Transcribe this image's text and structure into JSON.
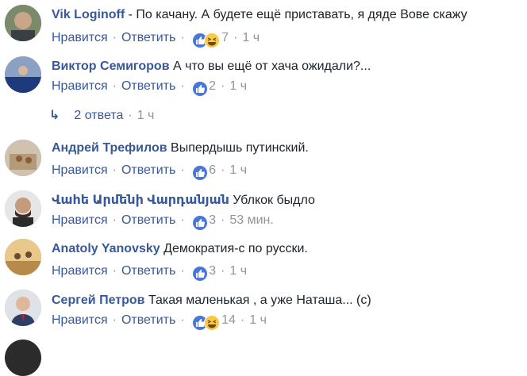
{
  "labels": {
    "like": "Нравится",
    "reply": "Ответить",
    "dot": "·"
  },
  "colors": {
    "link": "#385898",
    "meta": "#90949c",
    "text": "#1d2129",
    "like_badge": "#4a76d9",
    "haha_badge": "#f7c947"
  },
  "comments": [
    {
      "author": "Vik Loginoff",
      "text": "- По качану. А будете ещё приставать, я дяде Вове скажу",
      "reactions": [
        "like-icon",
        "haha-icon"
      ],
      "count": "7",
      "time": "1 ч"
    },
    {
      "author": "Виктор Семигоров",
      "text": "А что вы ещё от хача ожидали?...",
      "reactions": [
        "like-icon"
      ],
      "count": "2",
      "time": "1 ч"
    },
    {
      "author": "Андрей Трефилов",
      "text": "Выпердышь путинский.",
      "reactions": [
        "like-icon"
      ],
      "count": "6",
      "time": "1 ч"
    },
    {
      "author": "Վահե Արմենի Վարդանյան",
      "text": "Ублкок быдло",
      "reactions": [
        "like-icon"
      ],
      "count": "3",
      "time": "53 мин."
    },
    {
      "author": "Anatoly Yanovsky",
      "text": "Демократия-с по русски.",
      "reactions": [
        "like-icon"
      ],
      "count": "3",
      "time": "1 ч"
    },
    {
      "author": "Сергей Петров",
      "text": "Такая маленькая , а уже Наташа... (с)",
      "reactions": [
        "like-icon",
        "haha-icon"
      ],
      "count": "14",
      "time": "1 ч"
    }
  ],
  "replies": {
    "arrow": "↳",
    "label": "2 ответа",
    "time": "1 ч"
  }
}
